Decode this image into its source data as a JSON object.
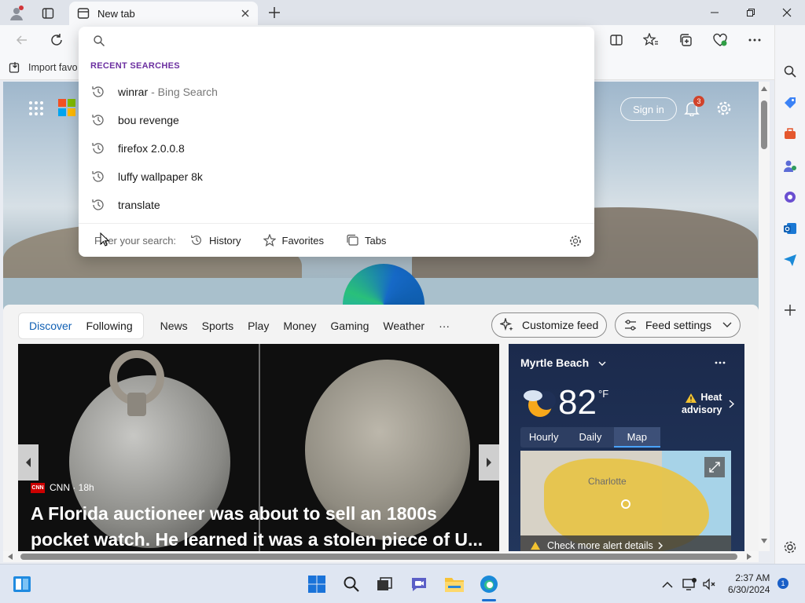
{
  "browser": {
    "tab_title": "New tab",
    "favorites_bar_label": "Import favo"
  },
  "address_dropdown": {
    "recent_label": "RECENT SEARCHES",
    "suggestions": [
      {
        "text": "winrar",
        "sub": "- Bing Search"
      },
      {
        "text": "bou revenge",
        "sub": ""
      },
      {
        "text": "firefox 2.0.0.8",
        "sub": ""
      },
      {
        "text": "luffy wallpaper 8k",
        "sub": ""
      },
      {
        "text": "translate",
        "sub": ""
      }
    ],
    "filter_label": "Filter your search:",
    "filters": [
      "History",
      "Favorites",
      "Tabs"
    ]
  },
  "hero": {
    "sign_in": "Sign in",
    "notification_count": "3"
  },
  "feed": {
    "tabs": [
      "Discover",
      "Following"
    ],
    "nav_links": [
      "News",
      "Sports",
      "Play",
      "Money",
      "Gaming",
      "Weather",
      "···"
    ],
    "customize": "Customize feed",
    "settings": "Feed settings"
  },
  "story": {
    "source": "CNN · 18h",
    "source_logo": "CNN",
    "headline": "A Florida auctioneer was about to sell an 1800s pocket watch. He learned it was a stolen piece of U..."
  },
  "weather": {
    "location": "Myrtle Beach",
    "temperature": "82",
    "unit": "°F",
    "alert_line1": "Heat",
    "alert_line2": "advisory",
    "tabs": [
      "Hourly",
      "Daily",
      "Map"
    ],
    "map_city": "Charlotte",
    "alert_details": "Check more alert details"
  },
  "taskbar": {
    "time": "2:37 AM",
    "date": "6/30/2024",
    "badge": "1"
  }
}
